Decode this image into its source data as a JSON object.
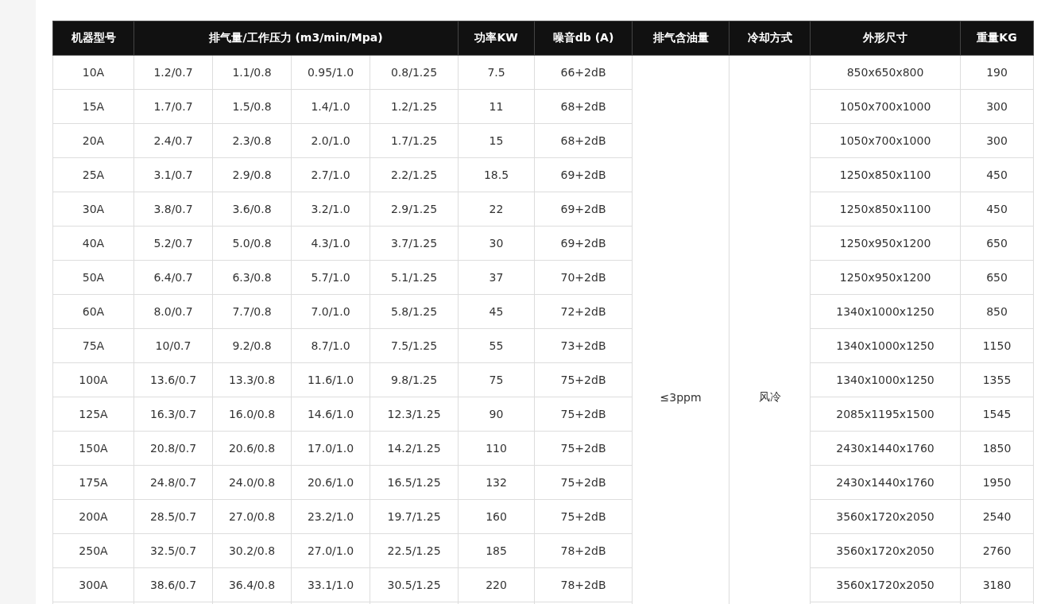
{
  "table": {
    "columns": [
      "机器型号",
      "排气量/工作压力 (m3/min/Mpa)",
      "功率KW",
      "噪音db (A)",
      "排气含油量",
      "冷却方式",
      "外形尺寸",
      "重量KG"
    ],
    "oil_content": "≤3ppm",
    "cooling": "风冷",
    "rows": [
      {
        "model": "10A",
        "flow": [
          "1.2/0.7",
          "1.1/0.8",
          "0.95/1.0",
          "0.8/1.25"
        ],
        "power": "7.5",
        "noise": "66+2dB",
        "size": "850x650x800",
        "weight": "190"
      },
      {
        "model": "15A",
        "flow": [
          "1.7/0.7",
          "1.5/0.8",
          "1.4/1.0",
          "1.2/1.25"
        ],
        "power": "11",
        "noise": "68+2dB",
        "size": "1050x700x1000",
        "weight": "300"
      },
      {
        "model": "20A",
        "flow": [
          "2.4/0.7",
          "2.3/0.8",
          "2.0/1.0",
          "1.7/1.25"
        ],
        "power": "15",
        "noise": "68+2dB",
        "size": "1050x700x1000",
        "weight": "300"
      },
      {
        "model": "25A",
        "flow": [
          "3.1/0.7",
          "2.9/0.8",
          "2.7/1.0",
          "2.2/1.25"
        ],
        "power": "18.5",
        "noise": "69+2dB",
        "size": "1250x850x1100",
        "weight": "450"
      },
      {
        "model": "30A",
        "flow": [
          "3.8/0.7",
          "3.6/0.8",
          "3.2/1.0",
          "2.9/1.25"
        ],
        "power": "22",
        "noise": "69+2dB",
        "size": "1250x850x1100",
        "weight": "450"
      },
      {
        "model": "40A",
        "flow": [
          "5.2/0.7",
          "5.0/0.8",
          "4.3/1.0",
          "3.7/1.25"
        ],
        "power": "30",
        "noise": "69+2dB",
        "size": "1250x950x1200",
        "weight": "650"
      },
      {
        "model": "50A",
        "flow": [
          "6.4/0.7",
          "6.3/0.8",
          "5.7/1.0",
          "5.1/1.25"
        ],
        "power": "37",
        "noise": "70+2dB",
        "size": "1250x950x1200",
        "weight": "650"
      },
      {
        "model": "60A",
        "flow": [
          "8.0/0.7",
          "7.7/0.8",
          "7.0/1.0",
          "5.8/1.25"
        ],
        "power": "45",
        "noise": "72+2dB",
        "size": "1340x1000x1250",
        "weight": "850"
      },
      {
        "model": "75A",
        "flow": [
          "10/0.7",
          "9.2/0.8",
          "8.7/1.0",
          "7.5/1.25"
        ],
        "power": "55",
        "noise": "73+2dB",
        "size": "1340x1000x1250",
        "weight": "1150"
      },
      {
        "model": "100A",
        "flow": [
          "13.6/0.7",
          "13.3/0.8",
          "11.6/1.0",
          "9.8/1.25"
        ],
        "power": "75",
        "noise": "75+2dB",
        "size": "1340x1000x1250",
        "weight": "1355"
      },
      {
        "model": "125A",
        "flow": [
          "16.3/0.7",
          "16.0/0.8",
          "14.6/1.0",
          "12.3/1.25"
        ],
        "power": "90",
        "noise": "75+2dB",
        "size": "2085x1195x1500",
        "weight": "1545"
      },
      {
        "model": "150A",
        "flow": [
          "20.8/0.7",
          "20.6/0.8",
          "17.0/1.0",
          "14.2/1.25"
        ],
        "power": "110",
        "noise": "75+2dB",
        "size": "2430x1440x1760",
        "weight": "1850"
      },
      {
        "model": "175A",
        "flow": [
          "24.8/0.7",
          "24.0/0.8",
          "20.6/1.0",
          "16.5/1.25"
        ],
        "power": "132",
        "noise": "75+2dB",
        "size": "2430x1440x1760",
        "weight": "1950"
      },
      {
        "model": "200A",
        "flow": [
          "28.5/0.7",
          "27.0/0.8",
          "23.2/1.0",
          "19.7/1.25"
        ],
        "power": "160",
        "noise": "75+2dB",
        "size": "3560x1720x2050",
        "weight": "2540"
      },
      {
        "model": "250A",
        "flow": [
          "32.5/0.7",
          "30.2/0.8",
          "27.0/1.0",
          "22.5/1.25"
        ],
        "power": "185",
        "noise": "78+2dB",
        "size": "3560x1720x2050",
        "weight": "2760"
      },
      {
        "model": "300A",
        "flow": [
          "38.6/0.7",
          "36.4/0.8",
          "33.1/1.0",
          "30.5/1.25"
        ],
        "power": "220",
        "noise": "78+2dB",
        "size": "3560x1720x2050",
        "weight": "3180"
      }
    ]
  }
}
